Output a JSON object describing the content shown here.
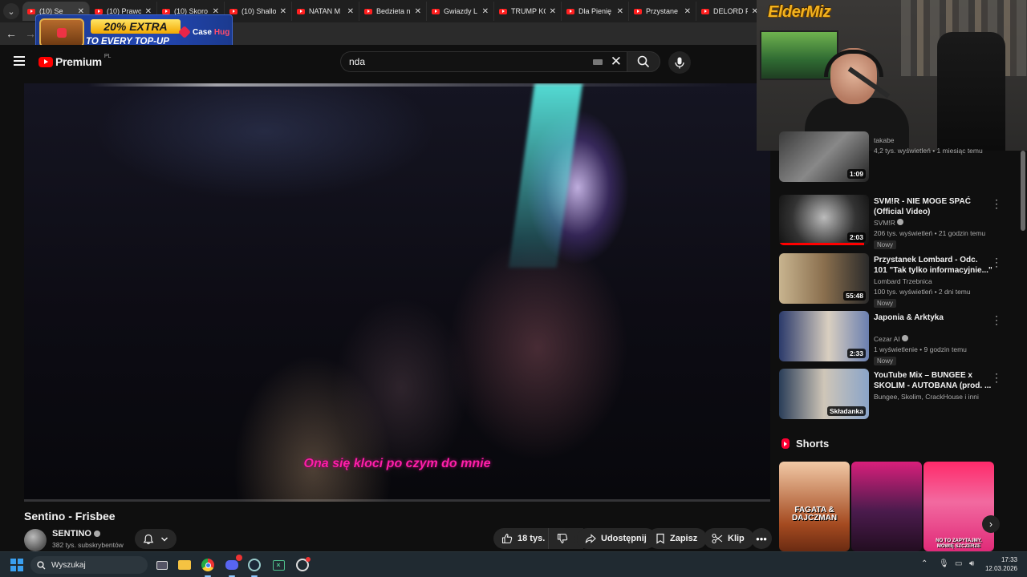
{
  "browser": {
    "tabs": [
      {
        "title": "(10) Se"
      },
      {
        "title": "(10) Prawo"
      },
      {
        "title": "(10) Skoro"
      },
      {
        "title": "(10) Shallo"
      },
      {
        "title": "NATAN M"
      },
      {
        "title": "Bedzieta n"
      },
      {
        "title": "Gwiazdy L"
      },
      {
        "title": "TRUMP KO"
      },
      {
        "title": "Dla Pienię"
      },
      {
        "title": "Przystane"
      },
      {
        "title": "DELORD P"
      }
    ]
  },
  "ad": {
    "line1": "20% EXTRA",
    "line2": "TO EVERY TOP-UP",
    "brand_a": "Case",
    "brand_b": "Hug"
  },
  "youtube": {
    "logo_word": "Premium",
    "logo_region": "PL",
    "search_value": "nda"
  },
  "video": {
    "subtitle": "Ona się kloci po czym do mnie",
    "title": "Sentino - Frisbee",
    "channel": "SENTINO",
    "subscribers": "382 tys. subskrybentów",
    "likes": "18 tys.",
    "share_label": "Udostępnij",
    "save_label": "Zapisz",
    "clip_label": "Klip"
  },
  "webcam": {
    "logo_text": "ElderMiz"
  },
  "recommendations": [
    {
      "title": "",
      "channel": "takabe",
      "meta": "4,2 tys. wyświetleń • 1 miesiąc temu",
      "duration": "1:09",
      "badge": "",
      "verified": false,
      "thumb": "linear-gradient(135deg,#3a3a3a,#888 50%,#222)"
    },
    {
      "title": "SVM!R - NIE MOGE SPAĆ (Official Video)",
      "channel": "SVM!R",
      "meta": "206 tys. wyświetleń • 21 godzin temu",
      "duration": "2:03",
      "badge": "Nowy",
      "verified": true,
      "progress": 0.95,
      "thumb": "radial-gradient(circle at 50% 45%,#bbb,#333 60%,#111)"
    },
    {
      "title": "Przystanek Lombard - Odc. 101 \"Tak tylko informacyjnie...\"",
      "channel": "Lombard Trzebnica",
      "meta": "100 tys. wyświetleń • 2 dni temu",
      "duration": "55:48",
      "badge": "Nowy",
      "verified": false,
      "thumb": "linear-gradient(90deg,#c8b48f,#8a6f4e 50%,#2a2a2a)"
    },
    {
      "title": "Japonia & Arktyka",
      "channel": "Cezar AI",
      "meta": "1 wyświetlenie • 9 godzin temu",
      "duration": "2:33",
      "badge": "Nowy",
      "verified": true,
      "thumb": "linear-gradient(90deg,#2b3a6b,#d9cfc0 55%,#6a7fb0)"
    },
    {
      "title": "YouTube Mix – BUNGEE x SKOLIM - AUTOBANA (prod. ...",
      "channel": "Bungee, Skolim, CrackHouse i inni",
      "meta": "",
      "duration": "Składanka",
      "badge": "",
      "verified": false,
      "thumb": "linear-gradient(90deg,#2a3d58,#cfc6b8 50%,#8aa4c8)"
    }
  ],
  "shorts": {
    "header": "Shorts",
    "items": [
      {
        "text": "FAGATA & DAJCZMAN",
        "bg": "linear-gradient(180deg,#f1c9a6,#a44a20 70%,#6a2b12)"
      },
      {
        "text": "",
        "bg": "linear-gradient(180deg,#d91f7b,#4b1b4d 55%,#220d20)"
      },
      {
        "text": "NO TO ZAPYTAJMY, MÓWIĘ SZCZERZE",
        "bg": "linear-gradient(180deg,#ff2a6a,#f26aa0 45%,#e02a78)"
      }
    ]
  },
  "taskbar": {
    "search_label": "Wyszukaj",
    "time": "17:33",
    "date": "12.03.2026"
  }
}
